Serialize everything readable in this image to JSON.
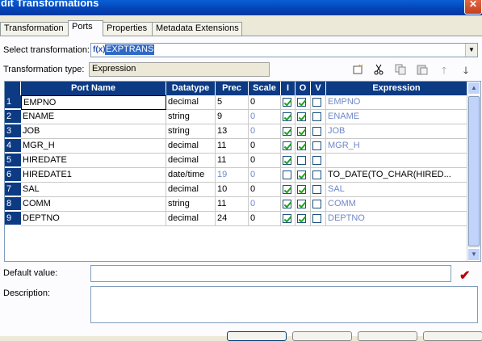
{
  "window": {
    "title": "dit Transformations",
    "close": "✕"
  },
  "tabs": [
    {
      "label": "Transformation"
    },
    {
      "label": "Ports"
    },
    {
      "label": "Properties"
    },
    {
      "label": "Metadata Extensions"
    }
  ],
  "select_transformation": {
    "label": "Select transformation:",
    "icon": "f(x)",
    "value": "EXPTRANS"
  },
  "transformation_type": {
    "label": "Transformation type:",
    "value": "Expression"
  },
  "toolbar": [
    "new-port-icon",
    "cut-icon",
    "copy-icon",
    "paste-icon",
    "move-up-icon",
    "move-down-icon"
  ],
  "grid": {
    "columns": [
      "Port Name",
      "Datatype",
      "Prec",
      "Scale",
      "I",
      "O",
      "V",
      "Expression"
    ],
    "rows": [
      {
        "n": "1",
        "name": "EMPNO",
        "type": "decimal",
        "prec": "5",
        "scale": "0",
        "i": true,
        "o": true,
        "v": false,
        "expr": "EMPNO",
        "expr_dim": true,
        "prec_dim": false,
        "scale_dim": false
      },
      {
        "n": "2",
        "name": "ENAME",
        "type": "string",
        "prec": "9",
        "scale": "0",
        "i": true,
        "o": true,
        "v": false,
        "expr": "ENAME",
        "expr_dim": true,
        "prec_dim": false,
        "scale_dim": true
      },
      {
        "n": "3",
        "name": "JOB",
        "type": "string",
        "prec": "13",
        "scale": "0",
        "i": true,
        "o": true,
        "v": false,
        "expr": "JOB",
        "expr_dim": true,
        "prec_dim": false,
        "scale_dim": true
      },
      {
        "n": "4",
        "name": "MGR_H",
        "type": "decimal",
        "prec": "11",
        "scale": "0",
        "i": true,
        "o": true,
        "v": false,
        "expr": "MGR_H",
        "expr_dim": true,
        "prec_dim": false,
        "scale_dim": false
      },
      {
        "n": "5",
        "name": "HIREDATE",
        "type": "decimal",
        "prec": "11",
        "scale": "0",
        "i": true,
        "o": false,
        "v": false,
        "expr": "",
        "expr_dim": false,
        "prec_dim": false,
        "scale_dim": false
      },
      {
        "n": "6",
        "name": "HIREDATE1",
        "type": "date/time",
        "prec": "19",
        "scale": "0",
        "i": false,
        "o": true,
        "v": false,
        "expr": "TO_DATE(TO_CHAR(HIRED...",
        "expr_dim": false,
        "prec_dim": true,
        "scale_dim": true
      },
      {
        "n": "7",
        "name": "SAL",
        "type": "decimal",
        "prec": "10",
        "scale": "0",
        "i": true,
        "o": true,
        "v": false,
        "expr": "SAL",
        "expr_dim": true,
        "prec_dim": false,
        "scale_dim": false
      },
      {
        "n": "8",
        "name": "COMM",
        "type": "string",
        "prec": "11",
        "scale": "0",
        "i": true,
        "o": true,
        "v": false,
        "expr": "COMM",
        "expr_dim": true,
        "prec_dim": false,
        "scale_dim": true
      },
      {
        "n": "9",
        "name": "DEPTNO",
        "type": "decimal",
        "prec": "24",
        "scale": "0",
        "i": true,
        "o": true,
        "v": false,
        "expr": "DEPTNO",
        "expr_dim": true,
        "prec_dim": false,
        "scale_dim": false
      }
    ]
  },
  "default_value": {
    "label": "Default value:",
    "value": ""
  },
  "description": {
    "label": "Description:",
    "value": ""
  },
  "colors": {
    "title": "#0442b5",
    "header": "#0c3b84",
    "dim_text": "#7088c8",
    "check": "#21a121"
  }
}
